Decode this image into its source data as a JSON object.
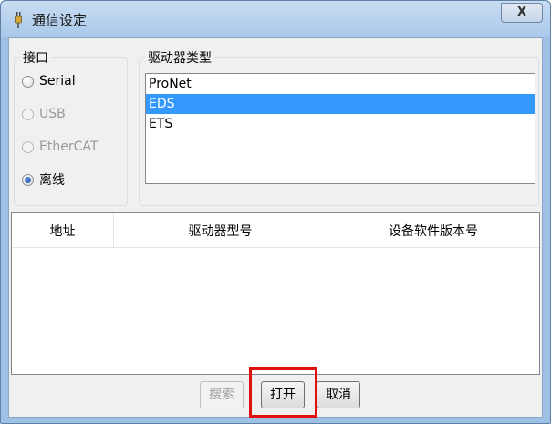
{
  "window": {
    "title": "通信设定",
    "close_label": "X",
    "icon": "plug-icon"
  },
  "interface_group": {
    "legend": "接口",
    "options": [
      {
        "label": "Serial",
        "checked": false,
        "enabled": true
      },
      {
        "label": "USB",
        "checked": false,
        "enabled": false
      },
      {
        "label": "EtherCAT",
        "checked": false,
        "enabled": false
      },
      {
        "label": "离线",
        "checked": true,
        "enabled": true
      }
    ]
  },
  "driver_type_group": {
    "legend": "驱动器类型",
    "items": [
      {
        "label": "ProNet",
        "selected": false
      },
      {
        "label": "EDS",
        "selected": true
      },
      {
        "label": "ETS",
        "selected": false
      }
    ]
  },
  "device_table": {
    "columns": [
      "地址",
      "驱动器型号",
      "设备软件版本号"
    ],
    "rows": []
  },
  "buttons": {
    "search_label": "搜索",
    "open_label": "打开",
    "cancel_label": "取消"
  },
  "colors": {
    "selection": "#3399ff",
    "highlight_outline": "#e01010"
  }
}
